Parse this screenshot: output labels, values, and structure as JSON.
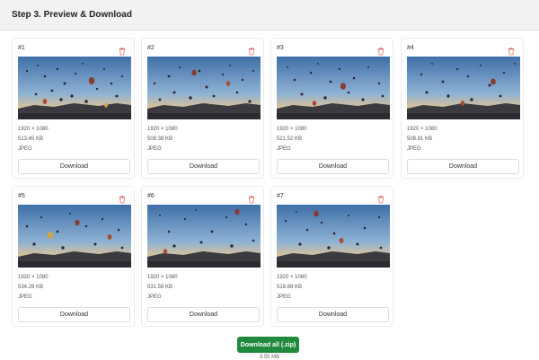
{
  "header": {
    "title": "Step 3. Preview & Download"
  },
  "cards": [
    {
      "num": "#1",
      "dimensions": "1920 × 1080",
      "size": "513.45 KB",
      "format": "JPEG",
      "download_label": "Download"
    },
    {
      "num": "#2",
      "dimensions": "1920 × 1080",
      "size": "508.38 KB",
      "format": "JPEG",
      "download_label": "Download"
    },
    {
      "num": "#3",
      "dimensions": "1920 × 1080",
      "size": "521.52 KB",
      "format": "JPEG",
      "download_label": "Download"
    },
    {
      "num": "#4",
      "dimensions": "1920 × 1080",
      "size": "508.81 KB",
      "format": "JPEG",
      "download_label": "Download"
    },
    {
      "num": "#5",
      "dimensions": "1920 × 1080",
      "size": "534.26 KB",
      "format": "JPEG",
      "download_label": "Download"
    },
    {
      "num": "#6",
      "dimensions": "1920 × 1080",
      "size": "531.58 KB",
      "format": "JPEG",
      "download_label": "Download"
    },
    {
      "num": "#7",
      "dimensions": "1920 × 1080",
      "size": "518.88 KB",
      "format": "JPEG",
      "download_label": "Download"
    }
  ],
  "footer": {
    "download_all_label": "Download all (.zip)",
    "total_size": "3.55 MB"
  },
  "icons": {
    "delete": "trash-icon"
  },
  "colors": {
    "primary_button": "#1f8a3c",
    "delete_icon": "#e0726b"
  }
}
